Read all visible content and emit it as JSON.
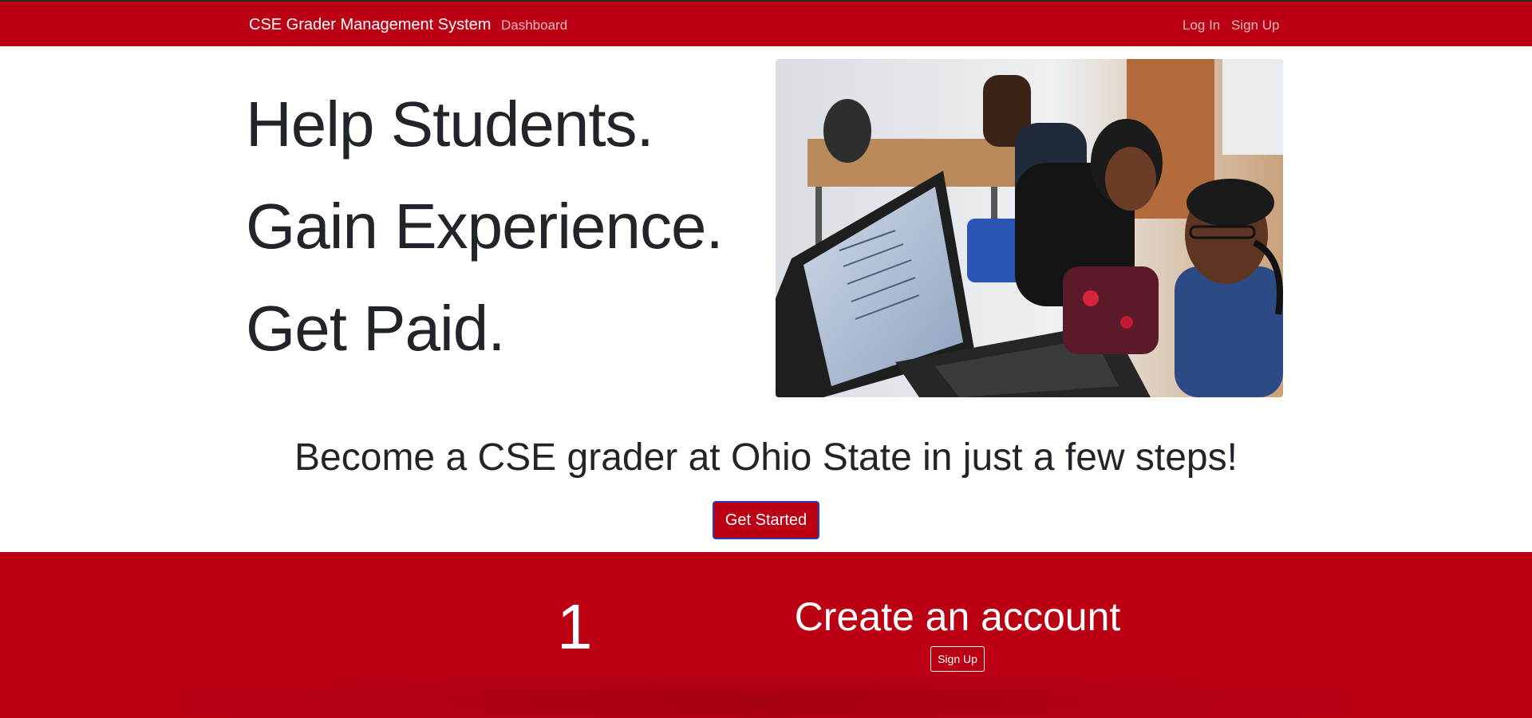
{
  "navbar": {
    "brand": "CSE Grader Management System",
    "dashboard_link": "Dashboard",
    "login_link": "Log In",
    "signup_link": "Sign Up",
    "background_color": "#bb0014"
  },
  "hero": {
    "lines": [
      "Help Students.",
      "Gain Experience.",
      "Get Paid."
    ],
    "image_icon": "students-at-laptop-photo"
  },
  "cta": {
    "tagline": "Become a CSE grader at Ohio State in just a few steps!",
    "button_label": "Get Started",
    "button_color": "#bb0014"
  },
  "steps": [
    {
      "number": "1",
      "title": "Create an account",
      "button_label": "Sign Up"
    }
  ]
}
